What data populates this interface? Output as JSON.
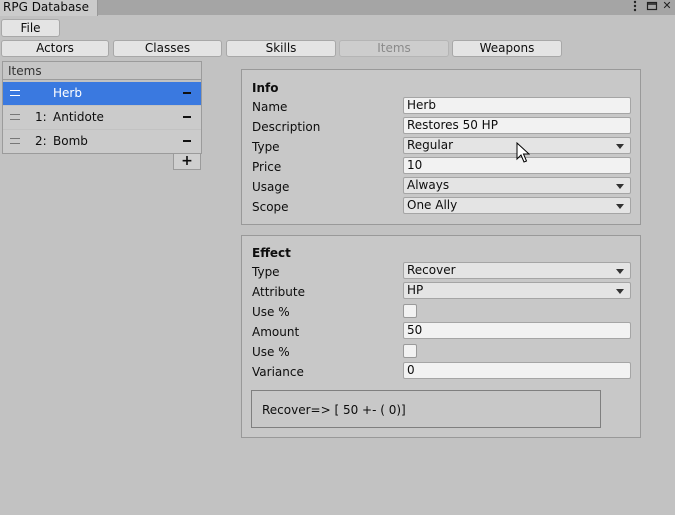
{
  "window": {
    "title": "RPG Database",
    "menu_icon": "kebab-menu-icon",
    "maximize_icon": "maximize-icon",
    "close_icon": "close-icon",
    "close_glyph": "✕"
  },
  "toolbar": {
    "file_label": "File"
  },
  "tabs": [
    {
      "label": "Actors",
      "disabled": false
    },
    {
      "label": "Classes",
      "disabled": false
    },
    {
      "label": "Skills",
      "disabled": false
    },
    {
      "label": "Items",
      "disabled": true
    },
    {
      "label": "Weapons",
      "disabled": false
    }
  ],
  "list": {
    "header": "Items",
    "rows": [
      {
        "index": "",
        "name": "Herb",
        "selected": true
      },
      {
        "index": "1:",
        "name": "Antidote",
        "selected": false
      },
      {
        "index": "2:",
        "name": "Bomb",
        "selected": false
      }
    ],
    "add_label": "+"
  },
  "info": {
    "heading": "Info",
    "name_label": "Name",
    "name_value": "Herb",
    "description_label": "Description",
    "description_value": "Restores 50 HP",
    "type_label": "Type",
    "type_value": "Regular",
    "price_label": "Price",
    "price_value": "10",
    "usage_label": "Usage",
    "usage_value": "Always",
    "scope_label": "Scope",
    "scope_value": "One Ally"
  },
  "effect": {
    "heading": "Effect",
    "type_label": "Type",
    "type_value": "Recover",
    "attribute_label": "Attribute",
    "attribute_value": "HP",
    "use_pct_label_1": "Use %",
    "use_pct_checked_1": false,
    "amount_label": "Amount",
    "amount_value": "50",
    "use_pct_label_2": "Use %",
    "use_pct_checked_2": false,
    "variance_label": "Variance",
    "variance_value": "0",
    "summary": "Recover=> [ 50 +- ( 0)]"
  },
  "colors": {
    "selection": "#3a79e0",
    "background": "#c2c2c2"
  }
}
